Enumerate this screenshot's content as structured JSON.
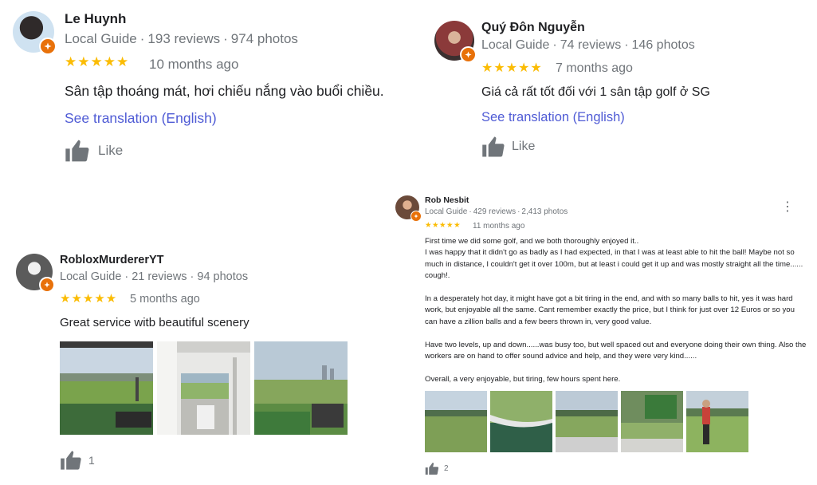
{
  "reviews": [
    {
      "name": "Le Huynh",
      "badge": "Local Guide",
      "reviews_count": "193 reviews",
      "photos_count": "974 photos",
      "stars": "★★★★★",
      "rating": 5,
      "time_ago": "10 months ago",
      "text": "Sân tập thoáng mát, hơi chiếu nắng vào buổi chiều.",
      "translation_link": "See translation (English)",
      "like_label": "Like"
    },
    {
      "name": "Quý Đôn Nguyễn",
      "badge": "Local Guide",
      "reviews_count": "74 reviews",
      "photos_count": "146 photos",
      "stars": "★★★★★",
      "rating": 5,
      "time_ago": "7 months ago",
      "text": "Giá cả rất tốt đối với 1 sân tập golf ở SG",
      "translation_link": "See translation (English)",
      "like_label": "Like"
    },
    {
      "name": "RobloxMurdererYT",
      "badge": "Local Guide",
      "reviews_count": "21 reviews",
      "photos_count": "94 photos",
      "stars": "★★★★★",
      "rating": 5,
      "time_ago": "5 months ago",
      "text": "Great service witb beautiful scenery",
      "like_count": "1",
      "photos": [
        "photo-1",
        "photo-2",
        "photo-3"
      ]
    },
    {
      "name": "Rob Nesbit",
      "badge": "Local Guide",
      "reviews_count": "429 reviews",
      "photos_count": "2,413 photos",
      "stars": "★★★★★",
      "rating": 5,
      "time_ago": "11 months ago",
      "more_icon": "⋮",
      "text": "First time we did some golf, and we both thoroughly enjoyed it..\nI was happy that it didn't go as badly as I had expected, in that I was at least able to hit the ball! Maybe not so much in distance, I couldn't get it over 100m, but at least i could get it up and was mostly straight all the time...... cough!.\n\nIn a desperately hot day,  it might have got a bit tiring in the end, and with so many balls to hit, yes it was hard work, but enjoyable all the same. Cant remember exactly the price, but I think for just over 12 Euros or so you can have a zillion balls and a few beers thrown in, very good value.\n\nHave two levels, up and down......was busy too, but well spaced out and everyone doing their own thing. Also the workers are on hand to offer sound advice and help, and they were very kind......\n\nOverall, a very enjoyable, but tiring, few hours spent here.",
      "like_count": "2",
      "photos": [
        "photo-1",
        "photo-2",
        "photo-3",
        "photo-4",
        "photo-5"
      ]
    }
  ],
  "colors": {
    "star": "#fbbc04",
    "link": "#4f5bd5",
    "muted": "#70757a",
    "text": "#202124",
    "badge": "#e8710a"
  }
}
